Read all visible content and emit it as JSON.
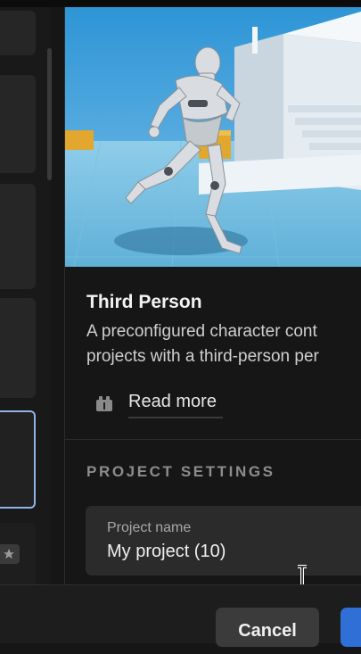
{
  "template": {
    "title": "Third Person",
    "description_lines": [
      "A preconfigured character cont",
      "projects with a third-person per"
    ],
    "read_more_label": "Read more"
  },
  "settings": {
    "heading": "PROJECT SETTINGS",
    "project_name_label": "Project name",
    "project_name_value": "My project (10)"
  },
  "footer": {
    "cancel_label": "Cancel"
  },
  "icons": {
    "read_more": "book-icon",
    "favorite": "star-icon",
    "cursor": "text-cursor-icon"
  },
  "colors": {
    "accent": "#2f6fd6",
    "selected_border": "#8fb4e6",
    "background": "#161616"
  }
}
